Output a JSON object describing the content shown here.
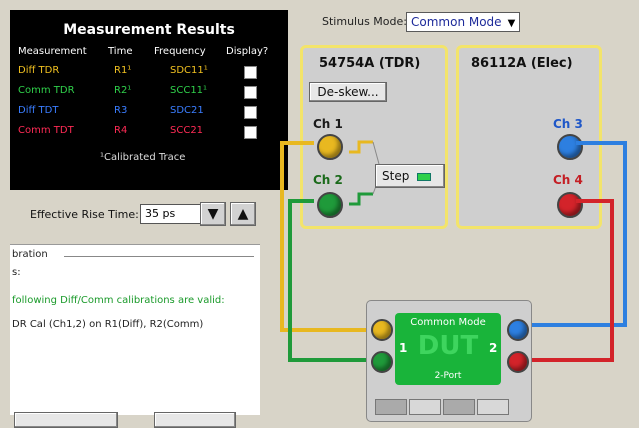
{
  "measurement_panel": {
    "title": "Measurement Results",
    "headers": [
      "Measurement",
      "Time",
      "Frequency",
      "Display?"
    ],
    "rows": [
      {
        "measurement": "Diff TDR",
        "time": "R1¹",
        "frequency": "SDC11¹",
        "color": "#f0c020"
      },
      {
        "measurement": "Comm TDR",
        "time": "R2¹",
        "frequency": "SCC11¹",
        "color": "#2fd04a"
      },
      {
        "measurement": "Diff TDT",
        "time": "R3",
        "frequency": "SDC21",
        "color": "#3a7dff"
      },
      {
        "measurement": "Comm TDT",
        "time": "R4",
        "frequency": "SCC21",
        "color": "#ff2b55"
      }
    ],
    "footer": "¹Calibrated Trace"
  },
  "stimulus": {
    "label": "Stimulus Mode:",
    "value": "Common Mode"
  },
  "tdr_module": {
    "title": "54754A (TDR)",
    "deskew_label": "De-skew...",
    "ch1": "Ch 1",
    "ch2": "Ch 2",
    "step_label": "Step"
  },
  "elec_module": {
    "title": "86112A (Elec)",
    "ch3": "Ch 3",
    "ch4": "Ch 4"
  },
  "rise_time": {
    "label": "Effective Rise Time:",
    "value": "35 ps"
  },
  "calibration": {
    "legend": "bration",
    "line1": "s:",
    "line2": "following Diff/Comm calibrations are valid:",
    "line3": "DR Cal (Ch1,2) on R1(Diff), R2(Comm)"
  },
  "dut": {
    "title": "Common Mode",
    "left_num": "1",
    "right_num": "2",
    "label": "DUT",
    "port_label": "2-Port"
  },
  "colors": {
    "yellow": "#e8b820",
    "green": "#1f9a3a",
    "blue": "#2d7fe0",
    "red": "#d3232a"
  },
  "icons": [
    "step-icon",
    "down-arrow-icon",
    "up-arrow-icon",
    "dropdown-arrow-icon",
    "checkbox-icon"
  ]
}
